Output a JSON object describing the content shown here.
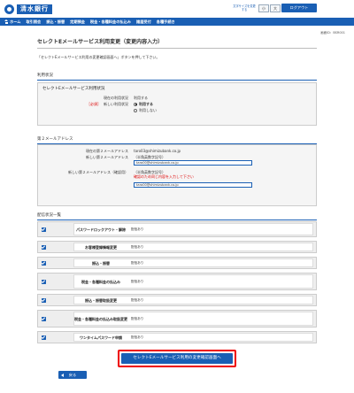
{
  "header": {
    "bank_name": "清水銀行",
    "small_note": "文字サイズを変更する",
    "font_small": "小",
    "font_large": "大",
    "logout": "ログアウト"
  },
  "nav": [
    "ホーム",
    "取引照会",
    "振込・振替",
    "定期預金",
    "税金・各種料金の払込み",
    "諸届受付",
    "各種手続き"
  ],
  "screen_id": "画面ID：BSR001",
  "page_title": "セレクトEメールサービス利用変更（変更内容入力）",
  "instruction": "「セレクトEメールサービス利用の変更確認画面へ」ボタンを押して下さい。",
  "usage": {
    "section": "利用状況",
    "panel_title": "セレクトEメールサービス利用状況",
    "current_label": "現在の利用状況",
    "current_value": "利用する",
    "required": "［必須］",
    "new_label": "新しい利用状況",
    "option_use": "利用する",
    "option_nouse": "利用しない"
  },
  "email2": {
    "section": "第２メールアドレス",
    "current_label": "現在の第２メールアドレス",
    "current_value": "taro03@shimizubank.co.jp",
    "new_label": "新しい第２メールアドレス",
    "hint": "（半角英数字記号）",
    "new_value": "taro00@shimizubank.co.jp",
    "confirm_label": "新しい第２メールアドレス（確認用）",
    "confirm_hint": "（半角英数字記号）",
    "confirm_warn": "確認のため同じ内容を入力して下さい",
    "confirm_value": "taro00@shimizubank.co.jp"
  },
  "delivery": {
    "section": "配信状況一覧",
    "status": "配信あり",
    "items": [
      "パスワードロックアウト・解除",
      "お客様登録情報変更",
      "振込・振替",
      "税金・各種料金の払込み",
      "振込・振替取扱変更",
      "税金・各種料金の払込み取扱変更",
      "ワンタイムパスワード申請"
    ]
  },
  "confirm_button": "セレクトEメールサービス利用の変更確認画面へ",
  "back_button": "戻る",
  "colors": {
    "brand": "#1a5fb4",
    "alert": "#e00000"
  }
}
